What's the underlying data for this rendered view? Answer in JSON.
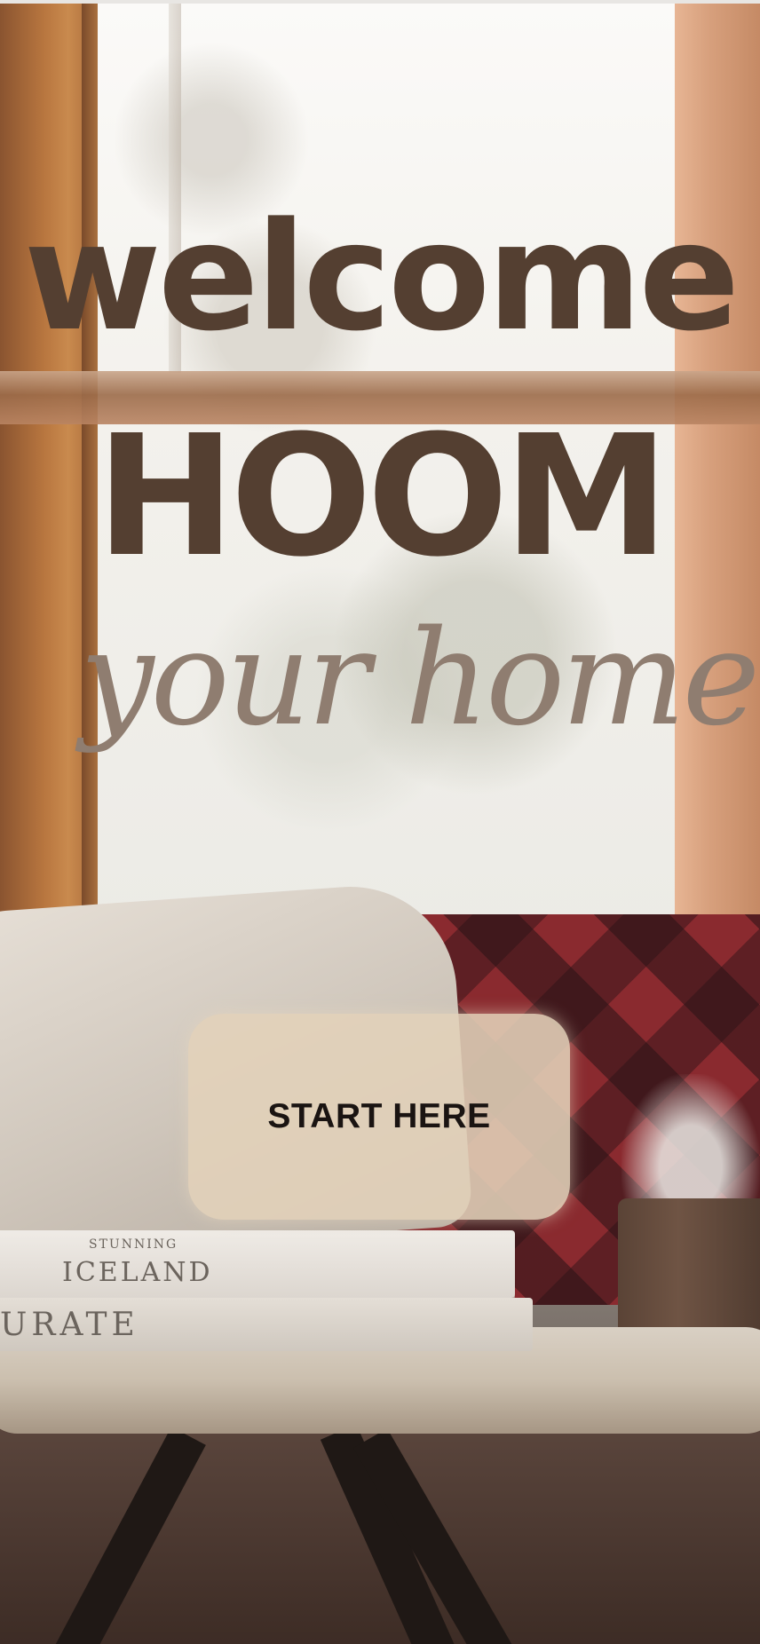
{
  "hero": {
    "line1": "welcome",
    "line2": "HOOM",
    "line3": "your home"
  },
  "cta": {
    "label": "START HERE"
  },
  "scene": {
    "book_top_subtitle": "STUNNING",
    "book_top_title": "ICELAND",
    "book_bottom_title": "URATE"
  },
  "colors": {
    "heading": "#543f31",
    "subheading": "#8f7d70",
    "button_bg": "#e2d2ba",
    "button_text": "#1a1412"
  }
}
